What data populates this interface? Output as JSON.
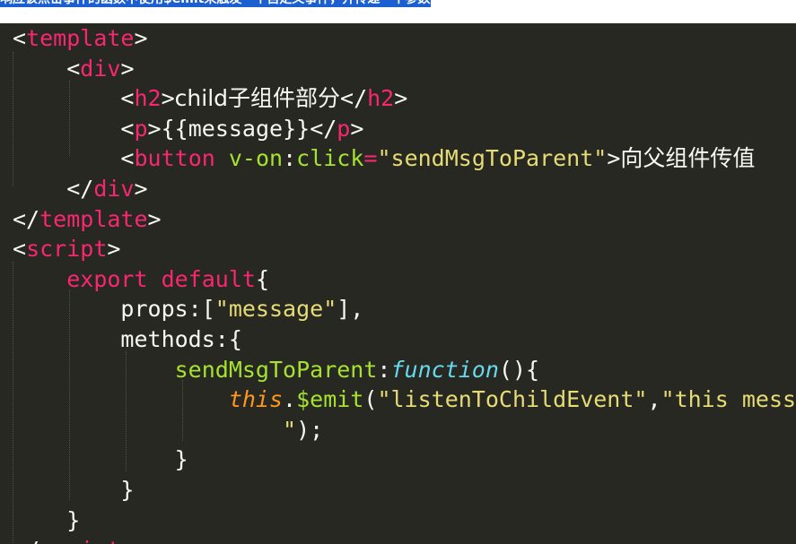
{
  "caption": {
    "text": "响应该点击事件的函数中使用$emit来触发一个自定义事件，并传递一个参数"
  },
  "colors": {
    "editor_background": "#272822",
    "tag": "#f92672",
    "attribute": "#a6e22e",
    "string": "#e6db74",
    "keyword": "#f92672",
    "function_keyword": "#66d9ef",
    "this_keyword": "#fd971f",
    "text": "#f8f8f2",
    "caption_highlight": "#1c5fd1"
  },
  "code": {
    "l1_open": "<",
    "l1_tag": "template",
    "l1_close": ">",
    "l2_open": "<",
    "l2_tag": "div",
    "l2_close": ">",
    "l3_open": "<",
    "l3_tag": "h2",
    "l3_close1": ">",
    "l3_text": "child子组件部分",
    "l3_endopen": "</",
    "l3_endtag": "h2",
    "l3_endclose": ">",
    "l4_open": "<",
    "l4_tag": "p",
    "l4_close1": ">",
    "l4_text": "{{message}}",
    "l4_endopen": "</",
    "l4_endtag": "p",
    "l4_endclose": ">",
    "l5_open": "<",
    "l5_tag": "button",
    "l5_space": " ",
    "l5_attr1": "v-on",
    "l5_colon": ":",
    "l5_attr2": "click",
    "l5_eq": "=",
    "l5_value": "\"sendMsgToParent\"",
    "l5_close": ">",
    "l5_text": "向父组件传值",
    "l6_open": "</",
    "l6_tag": "div",
    "l6_close": ">",
    "l7_open": "</",
    "l7_tag": "template",
    "l7_close": ">",
    "l8_open": "<",
    "l8_tag": "script",
    "l8_close": ">",
    "l9_kw1": "export",
    "l9_space": " ",
    "l9_kw2": "default",
    "l9_brace": "{",
    "l10_key": "props:[",
    "l10_str": "\"message\"",
    "l10_end": "],",
    "l11_key": "methods:{",
    "l12_name": "sendMsgToParent",
    "l12_colon": ":",
    "l12_fn": "function",
    "l12_rest": "(){",
    "l13_this": "this",
    "l13_dot": ".",
    "l13_emit": "$emit",
    "l13_paren": "(",
    "l13_str1": "\"listenToChildEvent\"",
    "l13_comma": ",",
    "l13_str2": "\"this message is from child",
    "l14_str": "\"",
    "l14_end": ");",
    "l15_brace": "}",
    "l16_brace": "}",
    "l17_brace": "}",
    "l18_open": "</",
    "l18_tag": "script",
    "l18_close": ">"
  }
}
